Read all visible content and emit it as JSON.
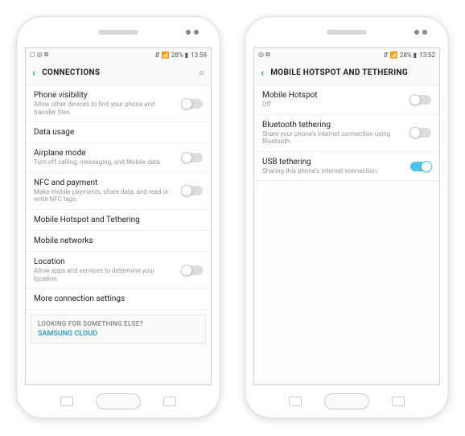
{
  "left": {
    "status": {
      "left": "◻ ◎ ⧉",
      "signal": "⇵ 📶 28% ▮",
      "time": "13:59"
    },
    "header": {
      "title": "CONNECTIONS"
    },
    "rows": [
      {
        "title": "Phone visibility",
        "sub": "Allow other devices to find your phone and transfer files.",
        "toggle": "off"
      },
      {
        "title": "Data usage"
      },
      {
        "title": "Airplane mode",
        "sub": "Turn off calling, messaging, and Mobile data.",
        "toggle": "off"
      },
      {
        "title": "NFC and payment",
        "sub": "Make mobile payments, share data, and read or write NFC tags.",
        "toggle": "off"
      },
      {
        "title": "Mobile Hotspot and Tethering"
      },
      {
        "title": "Mobile networks"
      },
      {
        "title": "Location",
        "sub": "Allow apps and services to determine your location.",
        "toggle": "off"
      },
      {
        "title": "More connection settings"
      }
    ],
    "footer": {
      "title": "LOOKING FOR SOMETHING ELSE?",
      "link": "SAMSUNG CLOUD"
    }
  },
  "right": {
    "status": {
      "left": "◎ ⧉",
      "signal": "⇵ 📶 28% ▮",
      "time": "13:52"
    },
    "header": {
      "title": "MOBILE HOTSPOT AND TETHERING"
    },
    "rows": [
      {
        "title": "Mobile Hotspot",
        "sub": "Off",
        "toggle": "off"
      },
      {
        "title": "Bluetooth tethering",
        "sub": "Share your phone's internet connection using Bluetooth.",
        "toggle": "off"
      },
      {
        "title": "USB tethering",
        "sub": "Sharing this phone's internet connection.",
        "toggle": "on"
      }
    ]
  }
}
